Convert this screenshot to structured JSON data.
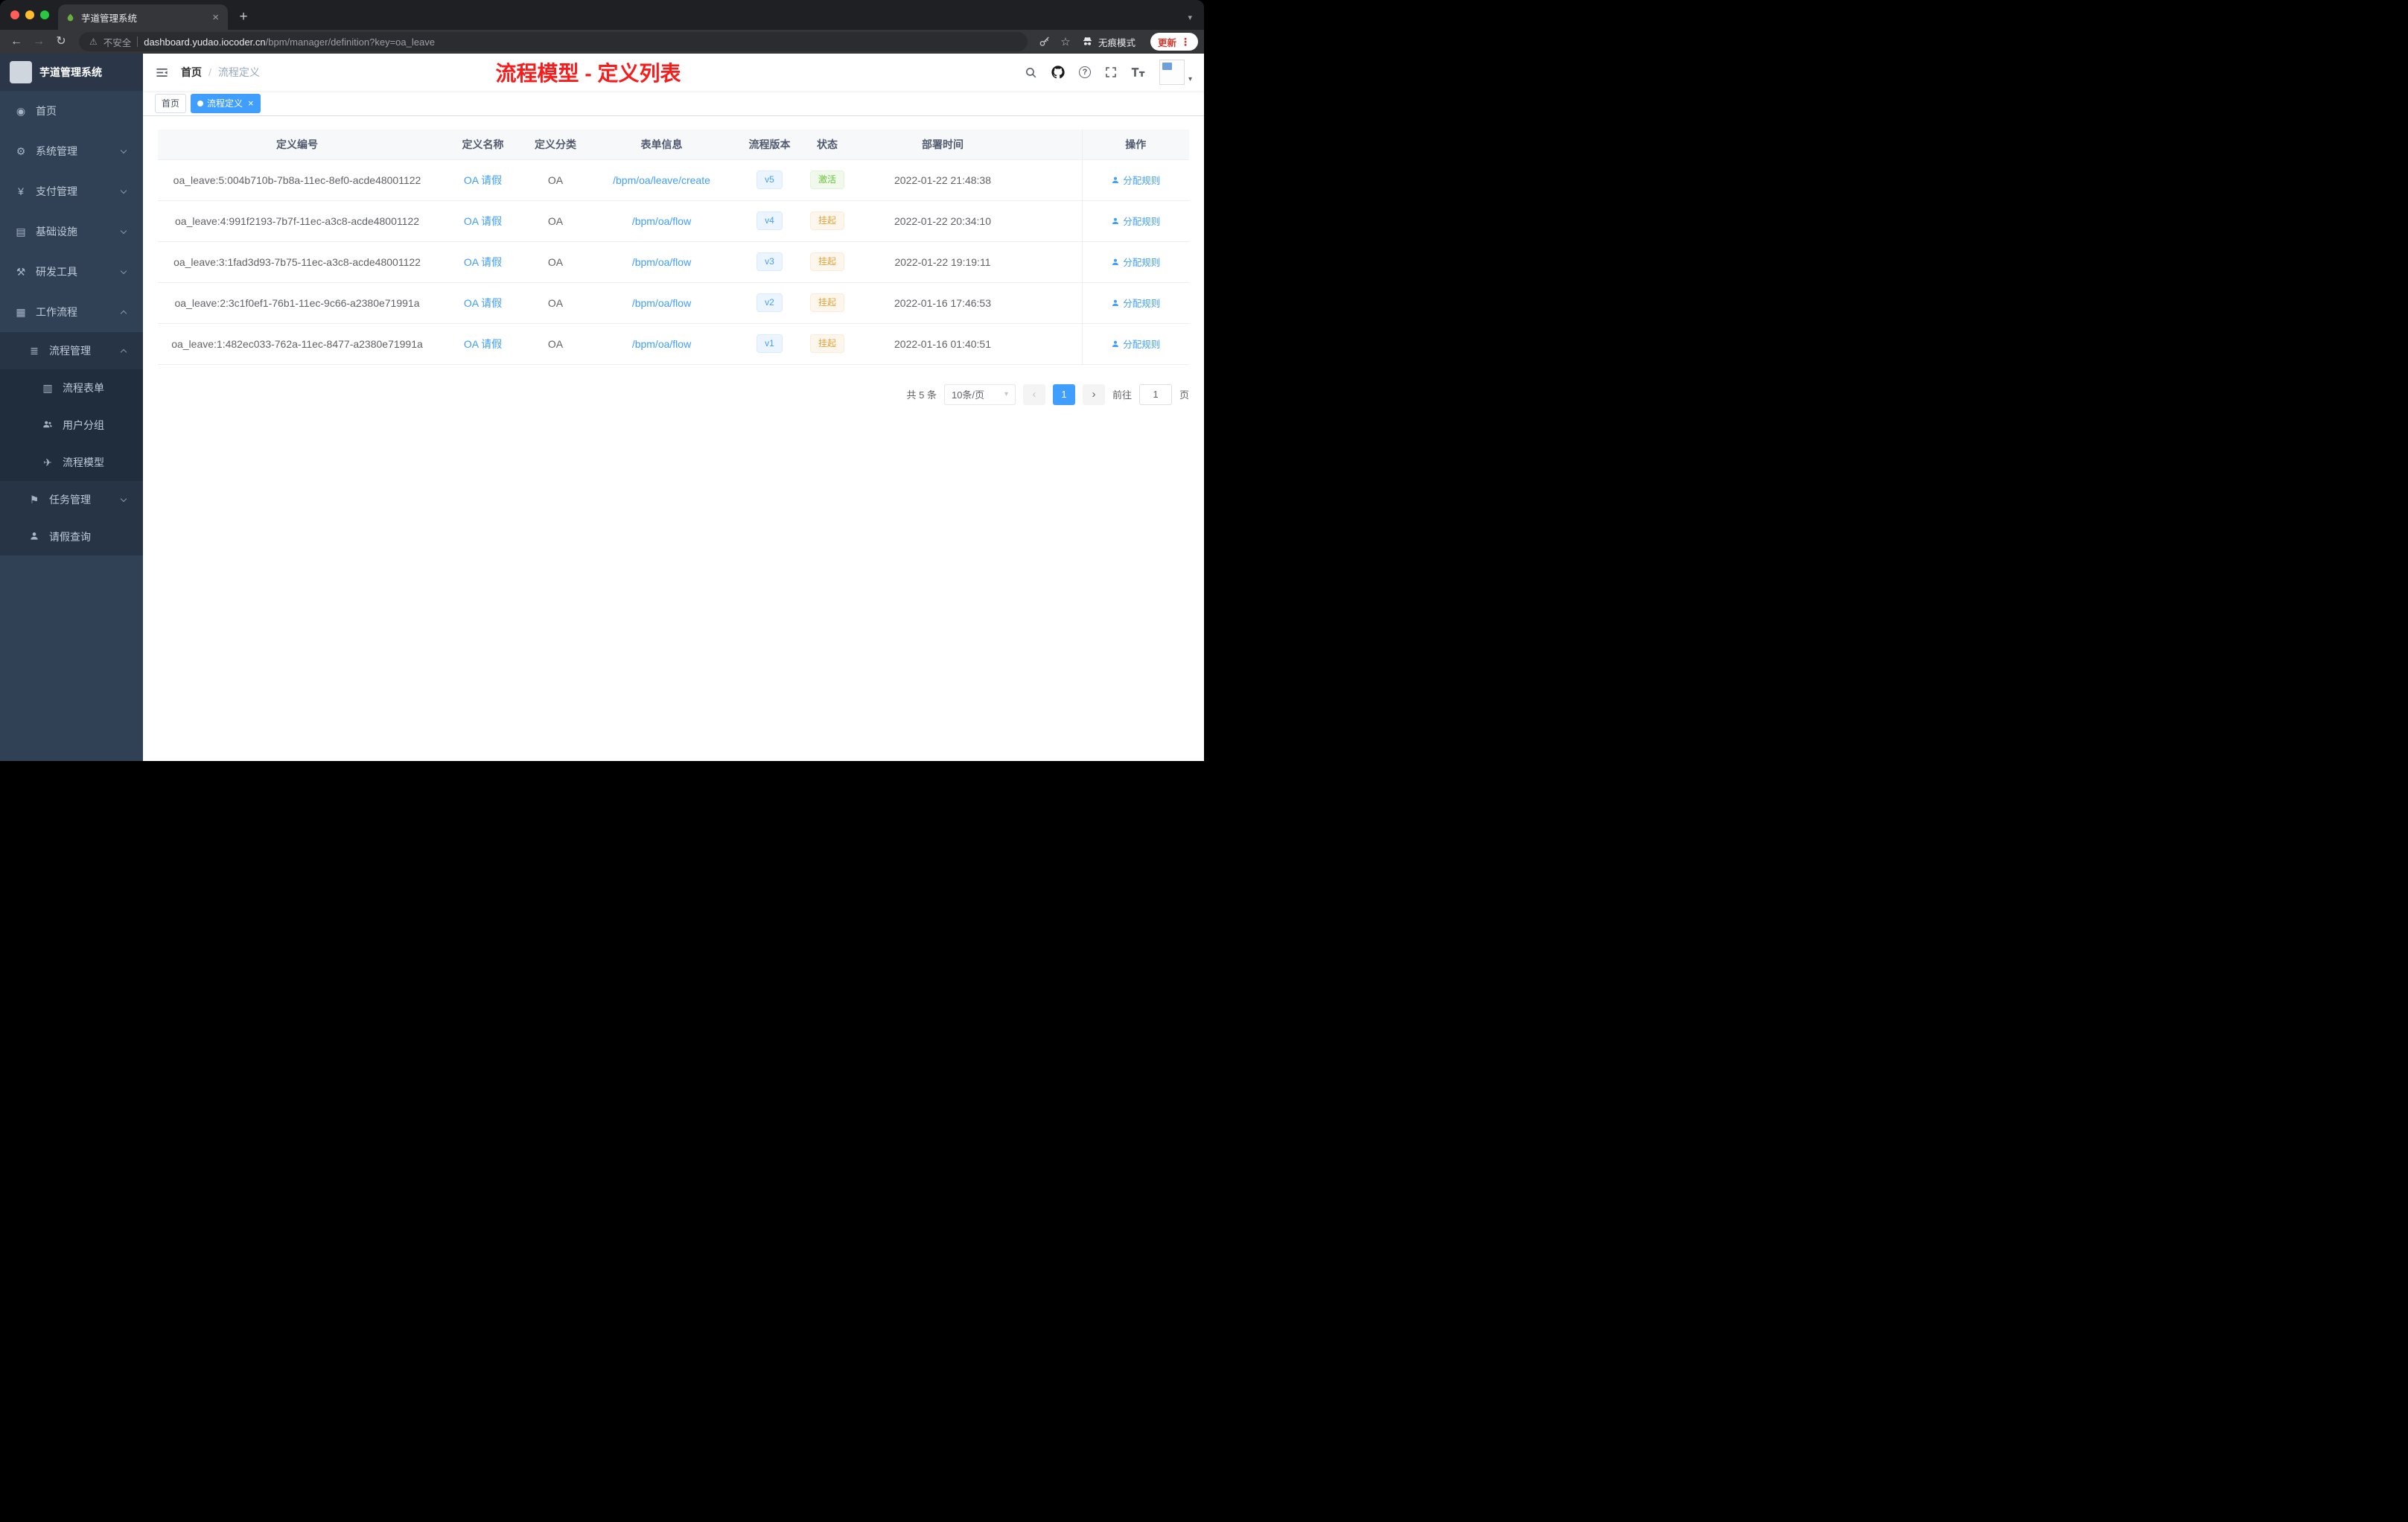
{
  "browser": {
    "tab_title": "芋道管理系统",
    "security_label": "不安全",
    "url_host": "dashboard.yudao.iocoder.cn",
    "url_path": "/bpm/manager/definition?key=oa_leave",
    "incognito_label": "无痕模式",
    "update_label": "更新"
  },
  "icons": {
    "back": "←",
    "forward": "→",
    "refresh": "↻",
    "warning": "⚠",
    "star": "☆",
    "menu_dots": "⋮",
    "close": "×",
    "plus": "+",
    "chevron_down": "▾",
    "prev": "‹",
    "next": "›",
    "help": "?",
    "dashboard": "◉",
    "system": "⚙",
    "pay": "¥",
    "infra": "▤",
    "dev": "⚒",
    "workflow": "▦",
    "process": "≣",
    "form": "▥",
    "model": "✈",
    "task": "⚑"
  },
  "sidebar": {
    "logo_title": "芋道管理系统",
    "items": [
      {
        "label": "首页"
      },
      {
        "label": "系统管理"
      },
      {
        "label": "支付管理"
      },
      {
        "label": "基础设施"
      },
      {
        "label": "研发工具"
      },
      {
        "label": "工作流程"
      },
      {
        "label": "流程管理"
      },
      {
        "label": "流程表单"
      },
      {
        "label": "用户分组"
      },
      {
        "label": "流程模型"
      },
      {
        "label": "任务管理"
      },
      {
        "label": "请假查询"
      }
    ]
  },
  "header": {
    "breadcrumb_home": "首页",
    "breadcrumb_separator": "/",
    "breadcrumb_current": "流程定义",
    "annotation": "流程模型 - 定义列表"
  },
  "tags_view": {
    "tags": [
      {
        "label": "首页"
      },
      {
        "label": "流程定义"
      }
    ]
  },
  "table": {
    "columns": [
      "定义编号",
      "定义名称",
      "定义分类",
      "表单信息",
      "流程版本",
      "状态",
      "部署时间",
      "操作"
    ],
    "rows": [
      {
        "id": "oa_leave:5:004b710b-7b8a-11ec-8ef0-acde48001122",
        "name": "OA 请假",
        "category": "OA",
        "form": "/bpm/oa/leave/create",
        "version": "v5",
        "status": "激活",
        "status_type": "success",
        "time": "2022-01-22 21:48:38",
        "action": "分配规则"
      },
      {
        "id": "oa_leave:4:991f2193-7b7f-11ec-a3c8-acde48001122",
        "name": "OA 请假",
        "category": "OA",
        "form": "/bpm/oa/flow",
        "version": "v4",
        "status": "挂起",
        "status_type": "warning",
        "time": "2022-01-22 20:34:10",
        "action": "分配规则"
      },
      {
        "id": "oa_leave:3:1fad3d93-7b75-11ec-a3c8-acde48001122",
        "name": "OA 请假",
        "category": "OA",
        "form": "/bpm/oa/flow",
        "version": "v3",
        "status": "挂起",
        "status_type": "warning",
        "time": "2022-01-22 19:19:11",
        "action": "分配规则"
      },
      {
        "id": "oa_leave:2:3c1f0ef1-76b1-11ec-9c66-a2380e71991a",
        "name": "OA 请假",
        "category": "OA",
        "form": "/bpm/oa/flow",
        "version": "v2",
        "status": "挂起",
        "status_type": "warning",
        "time": "2022-01-16 17:46:53",
        "action": "分配规则"
      },
      {
        "id": "oa_leave:1:482ec033-762a-11ec-8477-a2380e71991a",
        "name": "OA 请假",
        "category": "OA",
        "form": "/bpm/oa/flow",
        "version": "v1",
        "status": "挂起",
        "status_type": "warning",
        "time": "2022-01-16 01:40:51",
        "action": "分配规则"
      }
    ]
  },
  "pagination": {
    "total": "共 5 条",
    "page_size": "10条/页",
    "page": "1",
    "goto_label": "前往",
    "goto_value": "1",
    "unit_label": "页"
  }
}
